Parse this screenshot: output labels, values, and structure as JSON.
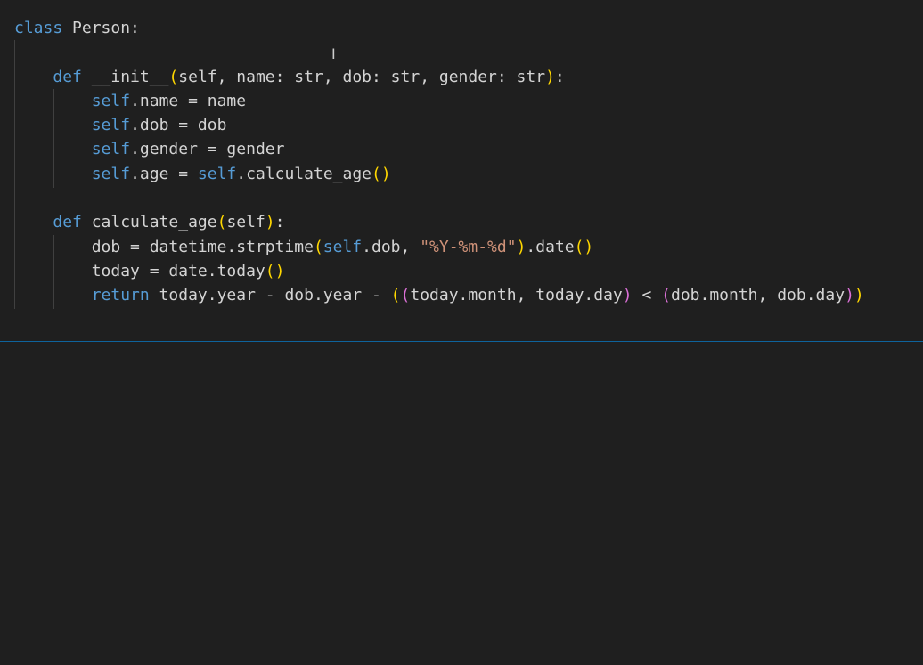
{
  "editor": {
    "lines": [
      [
        {
          "t": "class",
          "c": "kw"
        },
        {
          "t": " Person:",
          "c": ""
        }
      ],
      [],
      [
        {
          "t": "    ",
          "c": ""
        },
        {
          "t": "def",
          "c": "kw"
        },
        {
          "t": " __init__",
          "c": ""
        },
        {
          "t": "(",
          "c": "b1"
        },
        {
          "t": "self, name: str, dob: str, gender: str",
          "c": ""
        },
        {
          "t": ")",
          "c": "b1"
        },
        {
          "t": ":",
          "c": ""
        }
      ],
      [
        {
          "t": "        ",
          "c": ""
        },
        {
          "t": "self",
          "c": "kw"
        },
        {
          "t": ".name = name",
          "c": ""
        }
      ],
      [
        {
          "t": "        ",
          "c": ""
        },
        {
          "t": "self",
          "c": "kw"
        },
        {
          "t": ".dob = dob",
          "c": ""
        }
      ],
      [
        {
          "t": "        ",
          "c": ""
        },
        {
          "t": "self",
          "c": "kw"
        },
        {
          "t": ".gender = gender",
          "c": ""
        }
      ],
      [
        {
          "t": "        ",
          "c": ""
        },
        {
          "t": "self",
          "c": "kw"
        },
        {
          "t": ".age = ",
          "c": ""
        },
        {
          "t": "self",
          "c": "kw"
        },
        {
          "t": ".calculate_age",
          "c": ""
        },
        {
          "t": "()",
          "c": "b1"
        }
      ],
      [],
      [
        {
          "t": "    ",
          "c": ""
        },
        {
          "t": "def",
          "c": "kw"
        },
        {
          "t": " calculate_age",
          "c": ""
        },
        {
          "t": "(",
          "c": "b1"
        },
        {
          "t": "self",
          "c": ""
        },
        {
          "t": ")",
          "c": "b1"
        },
        {
          "t": ":",
          "c": ""
        }
      ],
      [
        {
          "t": "        dob = datetime.strptime",
          "c": ""
        },
        {
          "t": "(",
          "c": "b1"
        },
        {
          "t": "self",
          "c": "kw"
        },
        {
          "t": ".dob, ",
          "c": ""
        },
        {
          "t": "\"%Y-%m-%d\"",
          "c": "str"
        },
        {
          "t": ")",
          "c": "b1"
        },
        {
          "t": ".date",
          "c": ""
        },
        {
          "t": "()",
          "c": "b1"
        }
      ],
      [
        {
          "t": "        today = date.today",
          "c": ""
        },
        {
          "t": "()",
          "c": "b1"
        }
      ],
      [
        {
          "t": "        ",
          "c": ""
        },
        {
          "t": "return",
          "c": "ctl"
        },
        {
          "t": " today.year - dob.year - ",
          "c": ""
        },
        {
          "t": "(",
          "c": "b1"
        },
        {
          "t": "(",
          "c": "b2"
        },
        {
          "t": "today.month, today.day",
          "c": ""
        },
        {
          "t": ")",
          "c": "b2"
        },
        {
          "t": " < ",
          "c": ""
        },
        {
          "t": "(",
          "c": "b2"
        },
        {
          "t": "dob.month, dob.day",
          "c": ""
        },
        {
          "t": ")",
          "c": "b2"
        },
        {
          "t": ")",
          "c": "b1"
        }
      ]
    ]
  },
  "cursor": {
    "glyph": "I"
  }
}
